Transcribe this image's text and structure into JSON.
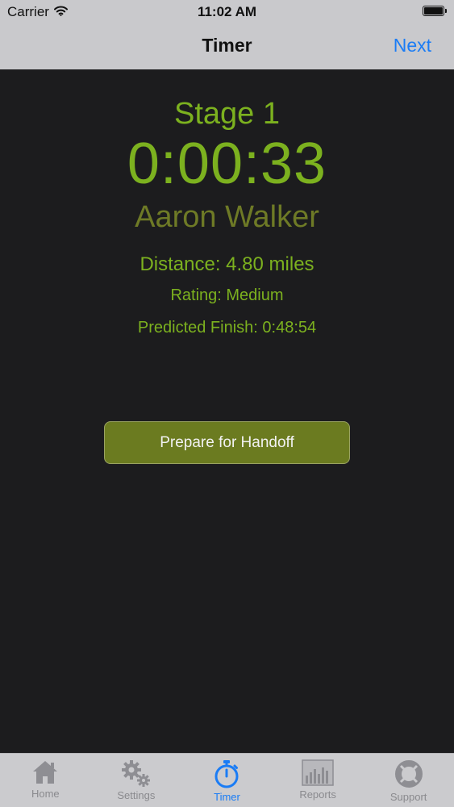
{
  "status_bar": {
    "carrier": "Carrier",
    "time": "11:02 AM"
  },
  "nav": {
    "title": "Timer",
    "next_label": "Next"
  },
  "timer": {
    "stage": "Stage 1",
    "elapsed": "0:00:33",
    "runner": "Aaron Walker",
    "distance": "Distance: 4.80 miles",
    "rating": "Rating: Medium",
    "predicted_finish": "Predicted Finish: 0:48:54"
  },
  "actions": {
    "handoff_label": "Prepare for Handoff"
  },
  "tabs": [
    {
      "label": "Home",
      "icon": "home-icon"
    },
    {
      "label": "Settings",
      "icon": "gears-icon"
    },
    {
      "label": "Timer",
      "icon": "stopwatch-icon",
      "active": true
    },
    {
      "label": "Reports",
      "icon": "bar-chart-icon"
    },
    {
      "label": "Support",
      "icon": "lifebuoy-icon"
    }
  ],
  "colors": {
    "accent_green": "#7cb11f",
    "runner_olive": "#6e7a26",
    "button_olive": "#6b7b20",
    "ios_blue": "#1a7cf5",
    "background": "#1c1c1e"
  }
}
